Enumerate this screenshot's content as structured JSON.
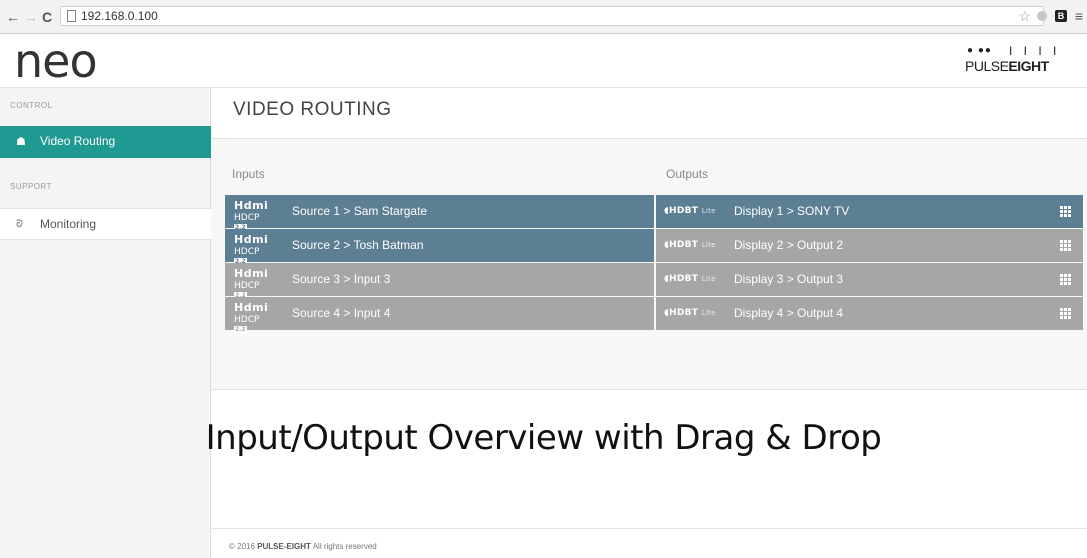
{
  "browser": {
    "url": "192.168.0.100",
    "back_glyph": "←",
    "forward_glyph": "→",
    "reload_glyph": "C",
    "star_glyph": "☆",
    "ext_badge": "B",
    "menu_glyph": "≡"
  },
  "app": {
    "logo": "neo",
    "brand": {
      "pre": "PULSE",
      "bold": "EIGHT",
      "dots": "● ●●",
      "bars": "I I I I"
    }
  },
  "sidebar": {
    "sections": [
      {
        "label": "CONTROL",
        "items": [
          {
            "label": "Video Routing",
            "icon": "home-icon",
            "glyph": "☗",
            "active": true
          }
        ]
      },
      {
        "label": "SUPPORT",
        "items": [
          {
            "label": "Monitoring",
            "icon": "rss-icon",
            "glyph": "ᘐ",
            "active": false
          }
        ]
      }
    ]
  },
  "main": {
    "title": "VIDEO ROUTING",
    "inputs_header": "Inputs",
    "outputs_header": "Outputs",
    "rows": [
      {
        "input": "Source 1 > Sam Stargate",
        "output": "Display 1 > SONY TV",
        "state": "active"
      },
      {
        "input": "Source 2 > Tosh Batman",
        "output": "Display 2 > Output 2",
        "state": "mixed"
      },
      {
        "input": "Source 3 > Input 3",
        "output": "Display 3 > Output 3",
        "state": "idle"
      },
      {
        "input": "Source 4 > Input 4",
        "output": "Display 4 > Output 4",
        "state": "idle"
      }
    ],
    "hdmi_top": "Hdmi",
    "hdmi_bottom": "HDCP",
    "hdcp_badge": "2.2",
    "hdbt": "HDBT",
    "hdbt_lite": "Lite"
  },
  "caption": "Input/Output Overview with Drag & Drop",
  "footer": {
    "pre": "© 2016 ",
    "bold": "PULSE-EIGHT",
    "post": " All rights reserved"
  },
  "colors": {
    "accent": "#1f9a93",
    "active_row": "#5d7f94",
    "idle_row": "#a6a6a6"
  }
}
